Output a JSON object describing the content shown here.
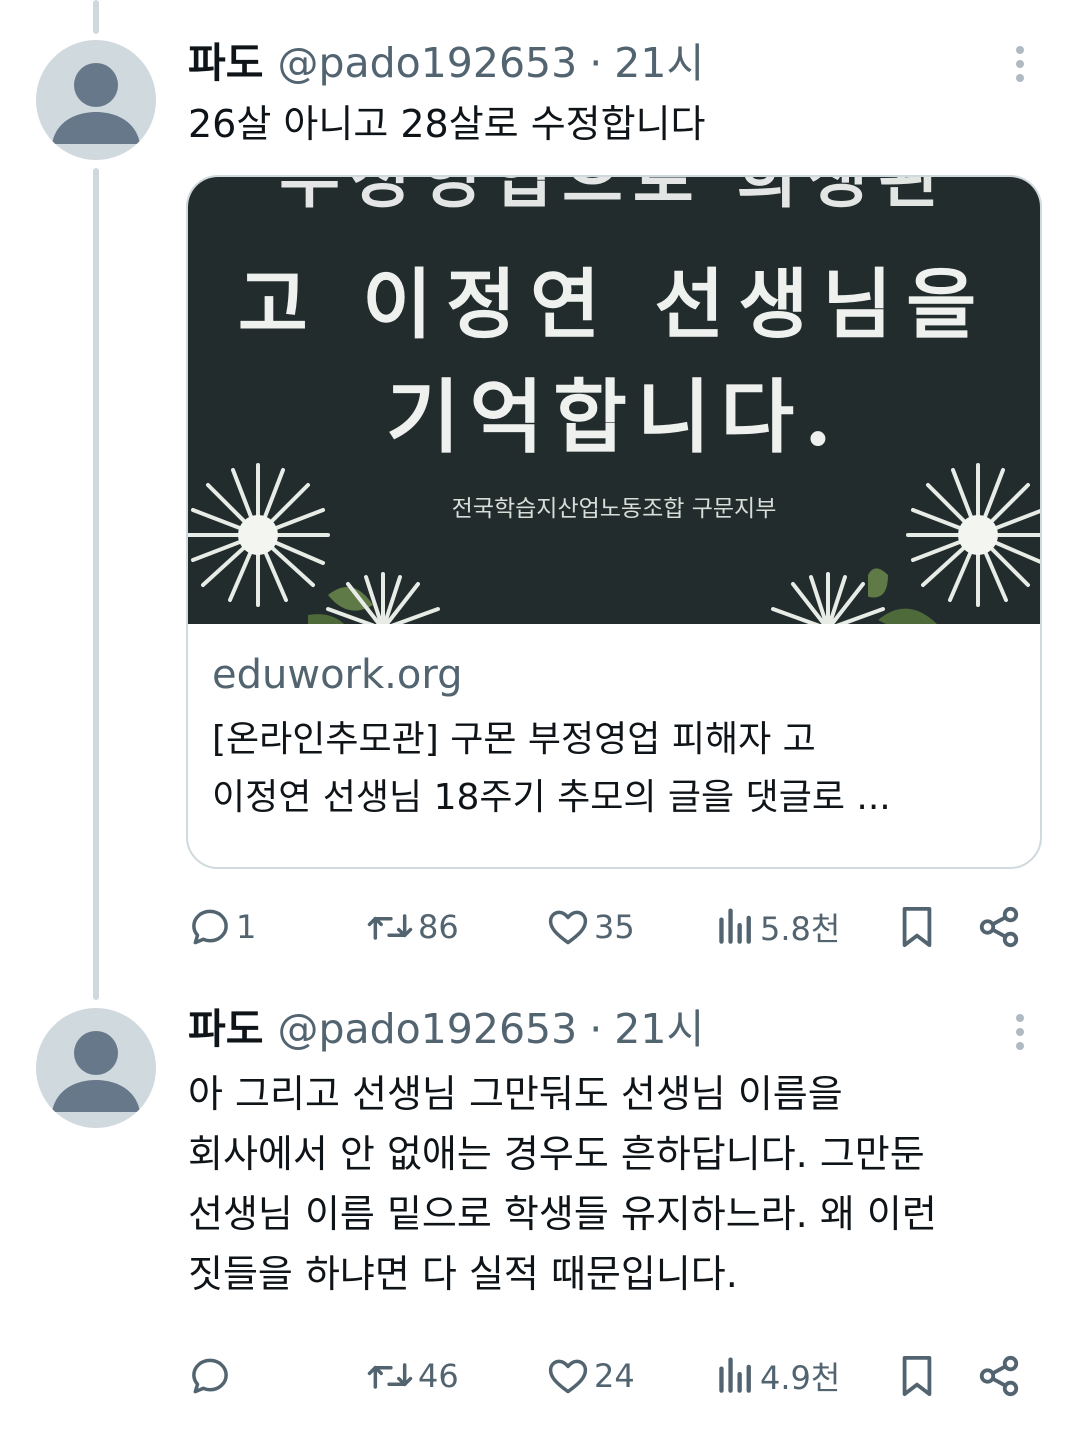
{
  "tweets": [
    {
      "display_name": "파도",
      "handle": "@pado192653",
      "separator": "·",
      "time": "21시",
      "text_lines": [
        "26살 아니고 28살로 수정합니다"
      ],
      "card": {
        "image_text_top": "부정영업으로 희생된",
        "image_text_line1": "고 이정연 선생님을",
        "image_text_line2": "기억합니다.",
        "image_subtitle": "전국학습지산업노동조합 구문지부",
        "domain": "eduwork.org",
        "title_line1": "[온라인추모관] 구몬 부정영업 피해자 고",
        "title_line2": "이정연 선생님 18주기 추모의 글을 댓글로 ..."
      },
      "stats": {
        "replies": "1",
        "retweets": "86",
        "likes": "35",
        "views": "5.8천"
      }
    },
    {
      "display_name": "파도",
      "handle": "@pado192653",
      "separator": "·",
      "time": "21시",
      "text_lines": [
        "아 그리고 선생님 그만둬도 선생님 이름을",
        "회사에서 안 없애는 경우도 흔하답니다. 그만둔",
        "선생님 이름 밑으로 학생들 유지하느라. 왜 이런",
        "짓들을 하냐면 다 실적 때문입니다."
      ],
      "stats": {
        "replies": "",
        "retweets": "46",
        "likes": "24",
        "views": "4.9천"
      }
    }
  ],
  "colors": {
    "text": "#0f1419",
    "secondary": "#536471",
    "thread_line": "#cfd9de",
    "card_image_bg": "#222c2d"
  },
  "icons": [
    "avatar-placeholder-icon",
    "more-icon",
    "reply-icon",
    "retweet-icon",
    "like-icon",
    "views-icon",
    "bookmark-icon",
    "share-icon"
  ]
}
